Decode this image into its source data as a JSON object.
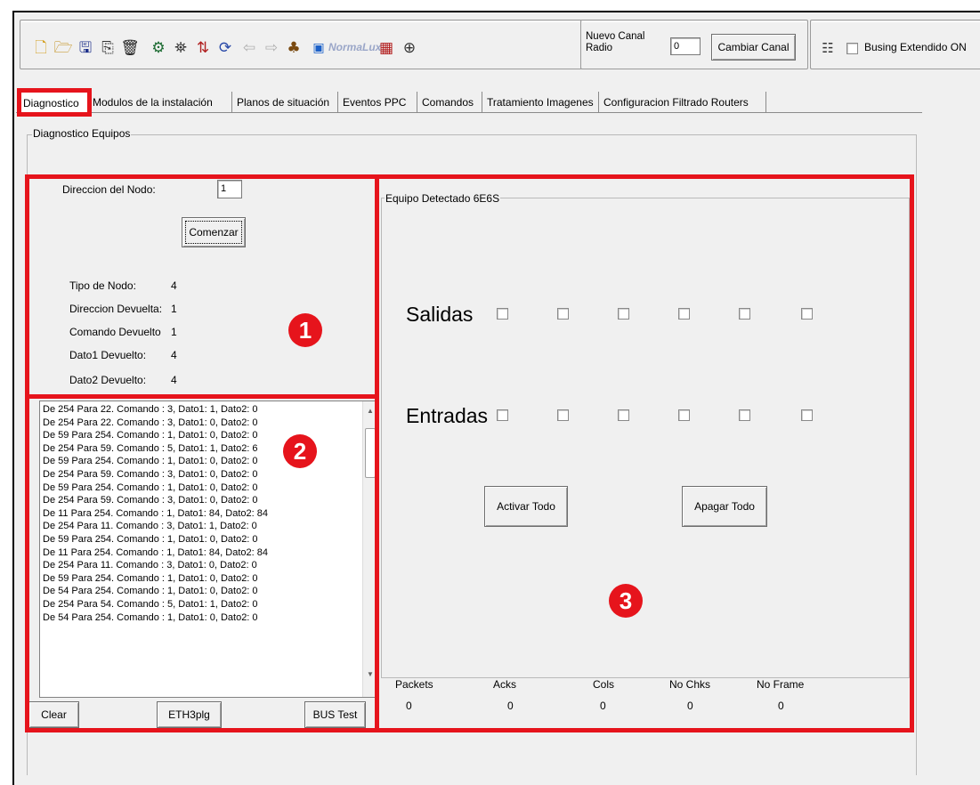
{
  "toolbar": {
    "icons": [
      "new-file-icon",
      "open-folder-icon",
      "save-icon",
      "copy-icon",
      "trash-icon",
      "settings-icon",
      "binoculars-icon",
      "network-icon",
      "refresh-icon",
      "arrow-left-icon",
      "arrow-right-icon",
      "tree-icon"
    ],
    "normalux_label": "NormaLux",
    "nuevo_canal_label": "Nuevo Canal Radio",
    "canal_value": "0",
    "cambiar_canal_label": "Cambiar Canal",
    "busing_label": "Busing Extendido ON"
  },
  "tabs": [
    {
      "label": "Diagnostico"
    },
    {
      "label": "Modulos de la instalación"
    },
    {
      "label": "Planos de situación"
    },
    {
      "label": "Eventos PPC"
    },
    {
      "label": "Comandos"
    },
    {
      "label": "Tratamiento Imagenes"
    },
    {
      "label": "Configuracion Filtrado Routers"
    }
  ],
  "diagnostico_equipos_title": "Diagnostico Equipos",
  "node": {
    "direccion_label": "Direccion del Nodo:",
    "direccion_value": "1",
    "comenzar_label": "Comenzar",
    "fields": [
      {
        "label": "Tipo de Nodo:",
        "value": "4"
      },
      {
        "label": "Direccion Devuelta:",
        "value": "1"
      },
      {
        "label": "Comando Devuelto",
        "value": "1"
      },
      {
        "label": "Dato1 Devuelto:",
        "value": "4"
      },
      {
        "label": "Dato2 Devuelto:",
        "value": "4"
      }
    ]
  },
  "log": {
    "lines": [
      "De 254 Para 22. Comando : 3, Dato1: 1, Dato2: 0",
      "De 254 Para 22. Comando : 3, Dato1: 0, Dato2: 0",
      "De 59 Para 254. Comando : 1, Dato1: 0, Dato2: 0",
      "De 254 Para 59. Comando : 5, Dato1: 1, Dato2: 6",
      "De 59 Para 254. Comando : 1, Dato1: 0, Dato2: 0",
      "De 254 Para 59. Comando : 3, Dato1: 0, Dato2: 0",
      "De 59 Para 254. Comando : 1, Dato1: 0, Dato2: 0",
      "De 254 Para 59. Comando : 3, Dato1: 0, Dato2: 0",
      "De 11 Para 254. Comando : 1, Dato1: 84, Dato2: 84",
      "De 254 Para 11. Comando : 3, Dato1: 1, Dato2: 0",
      "De 59 Para 254. Comando : 1, Dato1: 0, Dato2: 0",
      "De 11 Para 254. Comando : 1, Dato1: 84, Dato2: 84",
      "De 254 Para 11. Comando : 3, Dato1: 0, Dato2: 0",
      "De 59 Para 254. Comando : 1, Dato1: 0, Dato2: 0",
      "De 54 Para 254. Comando : 1, Dato1: 0, Dato2: 0",
      "De 254 Para 54. Comando : 5, Dato1: 1, Dato2: 0",
      "De 54 Para 254. Comando : 1, Dato1: 0, Dato2: 0"
    ],
    "clear_label": "Clear",
    "eth_label": "ETH3plg",
    "bustest_label": "BUS Test"
  },
  "equipo": {
    "title": "Equipo Detectado 6E6S",
    "salidas_label": "Salidas",
    "entradas_label": "Entradas",
    "activar_label": "Activar Todo",
    "apagar_label": "Apagar Todo"
  },
  "stats": [
    {
      "label": "Packets",
      "value": "0"
    },
    {
      "label": "Acks",
      "value": "0"
    },
    {
      "label": "Cols",
      "value": "0"
    },
    {
      "label": "No Chks",
      "value": "0"
    },
    {
      "label": "No Frame",
      "value": "0"
    }
  ],
  "badges": [
    "1",
    "2",
    "3"
  ],
  "colors": {
    "highlight": "#e6141c",
    "window_bg": "#f0f0f0"
  }
}
